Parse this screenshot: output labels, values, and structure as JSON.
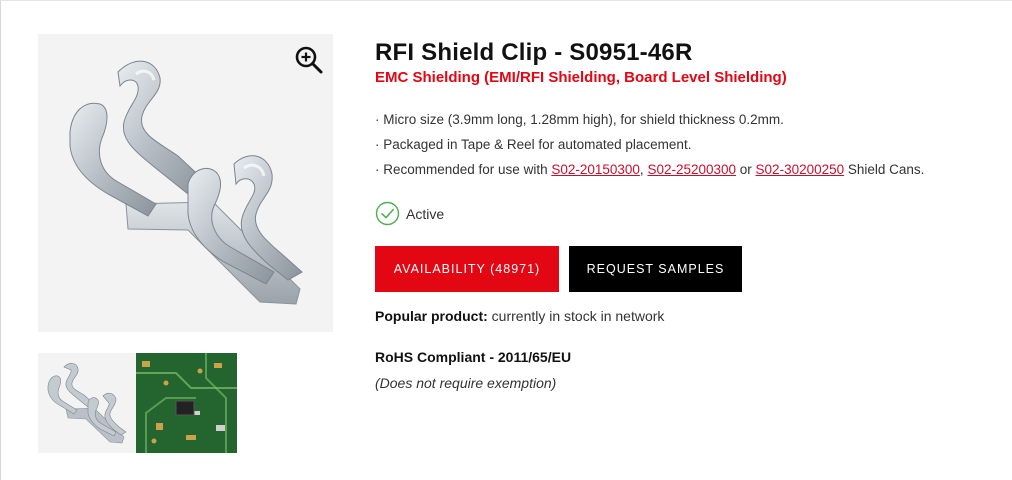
{
  "product": {
    "title": "RFI Shield Clip - S0951-46R",
    "category": "EMC Shielding (EMI/RFI Shielding, Board Level Shielding)"
  },
  "gallery": {
    "zoom_icon": "zoom-in-icon",
    "main_alt": "shield-clip-photo",
    "thumbnails": [
      "shield-clip-thumbnail",
      "pcb-application-thumbnail"
    ]
  },
  "features": {
    "item1": "· Micro size (3.9mm long, 1.28mm high), for shield thickness 0.2mm.",
    "item2": "· Packaged in Tape & Reel for automated placement.",
    "item3": {
      "prefix": "· Recommended for use with ",
      "link1": "S02-20150300",
      "sep1": ", ",
      "link2": "S02-25200300",
      "sep2": " or ",
      "link3": "S02-30200250",
      "suffix": " Shield Cans."
    }
  },
  "status": {
    "label": "Active",
    "icon": "check-circle-icon"
  },
  "buttons": {
    "availability": "AVAILABILITY (48971)",
    "samples": "REQUEST SAMPLES"
  },
  "popular": {
    "label": "Popular product:",
    "text": " currently in stock in network"
  },
  "rohs": {
    "title": "RoHS Compliant - 2011/65/EU",
    "note": "(Does not require exemption)"
  },
  "colors": {
    "accent": "#e30613",
    "link": "#c8102e",
    "dark_button": "#000000",
    "status_green": "#4caf50"
  }
}
